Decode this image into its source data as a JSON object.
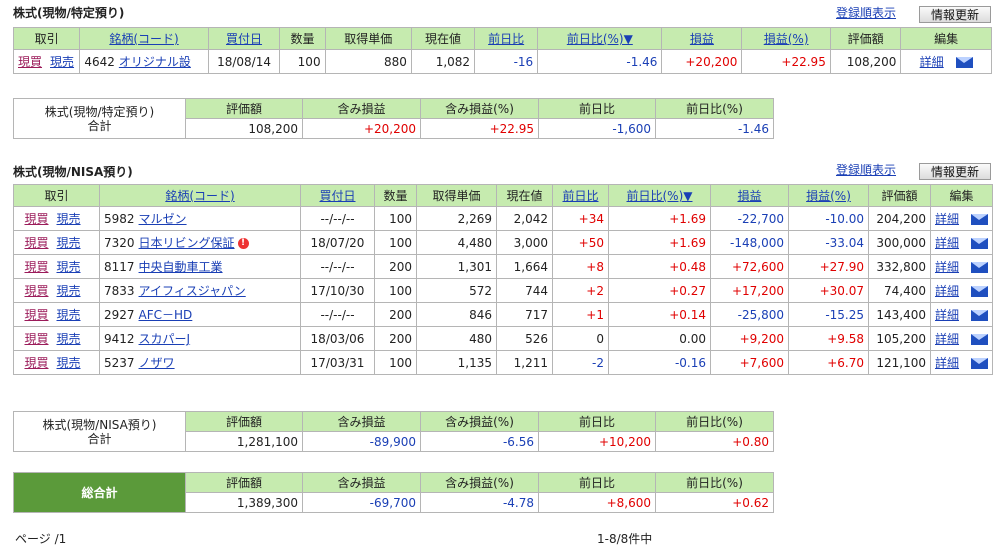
{
  "section1": {
    "title": "株式(現物/特定預り)",
    "sort_link": "登録順表示",
    "refresh_button": "情報更新",
    "headers": [
      "取引",
      "銘柄(コード)",
      "買付日",
      "数量",
      "取得単価",
      "現在値",
      "前日比",
      "前日比(%)▼",
      "損益",
      "損益(%)",
      "評価額",
      "編集"
    ],
    "rows": [
      {
        "buy": "現買",
        "sell": "現売",
        "code": "4642",
        "name": "オリジナル設",
        "date": "18/08/14",
        "qty": "100",
        "cost": "880",
        "price": "1,082",
        "chg": "-16",
        "chg_pct": "-1.46",
        "pl": "+20,200",
        "pl_pct": "+22.95",
        "value": "108,200",
        "detail": "詳細"
      }
    ],
    "summary": {
      "label1": "株式(現物/特定預り)",
      "label2": "合計",
      "headers": [
        "評価額",
        "含み損益",
        "含み損益(%)",
        "前日比",
        "前日比(%)"
      ],
      "values": [
        "108,200",
        "+20,200",
        "+22.95",
        "-1,600",
        "-1.46"
      ]
    }
  },
  "section2": {
    "title": "株式(現物/NISA預り)",
    "sort_link": "登録順表示",
    "refresh_button": "情報更新",
    "headers": [
      "取引",
      "銘柄(コード)",
      "買付日",
      "数量",
      "取得単価",
      "現在値",
      "前日比",
      "前日比(%)▼",
      "損益",
      "損益(%)",
      "評価額",
      "編集"
    ],
    "rows": [
      {
        "buy": "現買",
        "sell": "現売",
        "code": "5982",
        "name": "マルゼン",
        "date": "--/--/--",
        "qty": "100",
        "cost": "2,269",
        "price": "2,042",
        "chg": "+34",
        "chg_pct": "+1.69",
        "pl": "-22,700",
        "pl_pct": "-10.00",
        "value": "204,200",
        "detail": "詳細",
        "warn": false
      },
      {
        "buy": "現買",
        "sell": "現売",
        "code": "7320",
        "name": "日本リビング保証",
        "date": "18/07/20",
        "qty": "100",
        "cost": "4,480",
        "price": "3,000",
        "chg": "+50",
        "chg_pct": "+1.69",
        "pl": "-148,000",
        "pl_pct": "-33.04",
        "value": "300,000",
        "detail": "詳細",
        "warn": true
      },
      {
        "buy": "現買",
        "sell": "現売",
        "code": "8117",
        "name": "中央自動車工業",
        "date": "--/--/--",
        "qty": "200",
        "cost": "1,301",
        "price": "1,664",
        "chg": "+8",
        "chg_pct": "+0.48",
        "pl": "+72,600",
        "pl_pct": "+27.90",
        "value": "332,800",
        "detail": "詳細",
        "warn": false
      },
      {
        "buy": "現買",
        "sell": "現売",
        "code": "7833",
        "name": "アイフィスジャパン",
        "date": "17/10/30",
        "qty": "100",
        "cost": "572",
        "price": "744",
        "chg": "+2",
        "chg_pct": "+0.27",
        "pl": "+17,200",
        "pl_pct": "+30.07",
        "value": "74,400",
        "detail": "詳細",
        "warn": false
      },
      {
        "buy": "現買",
        "sell": "現売",
        "code": "2927",
        "name": "AFC－HD",
        "date": "--/--/--",
        "qty": "200",
        "cost": "846",
        "price": "717",
        "chg": "+1",
        "chg_pct": "+0.14",
        "pl": "-25,800",
        "pl_pct": "-15.25",
        "value": "143,400",
        "detail": "詳細",
        "warn": false
      },
      {
        "buy": "現買",
        "sell": "現売",
        "code": "9412",
        "name": "スカパーJ",
        "date": "18/03/06",
        "qty": "200",
        "cost": "480",
        "price": "526",
        "chg": "0",
        "chg_pct": "0.00",
        "pl": "+9,200",
        "pl_pct": "+9.58",
        "value": "105,200",
        "detail": "詳細",
        "warn": false
      },
      {
        "buy": "現買",
        "sell": "現売",
        "code": "5237",
        "name": "ノザワ",
        "date": "17/03/31",
        "qty": "100",
        "cost": "1,135",
        "price": "1,211",
        "chg": "-2",
        "chg_pct": "-0.16",
        "pl": "+7,600",
        "pl_pct": "+6.70",
        "value": "121,100",
        "detail": "詳細",
        "warn": false
      }
    ],
    "summary": {
      "label1": "株式(現物/NISA預り)",
      "label2": "合計",
      "headers": [
        "評価額",
        "含み損益",
        "含み損益(%)",
        "前日比",
        "前日比(%)"
      ],
      "values": [
        "1,281,100",
        "-89,900",
        "-6.56",
        "+10,200",
        "+0.80"
      ]
    }
  },
  "grand_total": {
    "label": "総合計",
    "headers": [
      "評価額",
      "含み損益",
      "含み損益(%)",
      "前日比",
      "前日比(%)"
    ],
    "values": [
      "1,389,300",
      "-69,700",
      "-4.78",
      "+8,600",
      "+0.62"
    ]
  },
  "footer": {
    "page": "ページ /1",
    "count": "1-8/8件中"
  }
}
